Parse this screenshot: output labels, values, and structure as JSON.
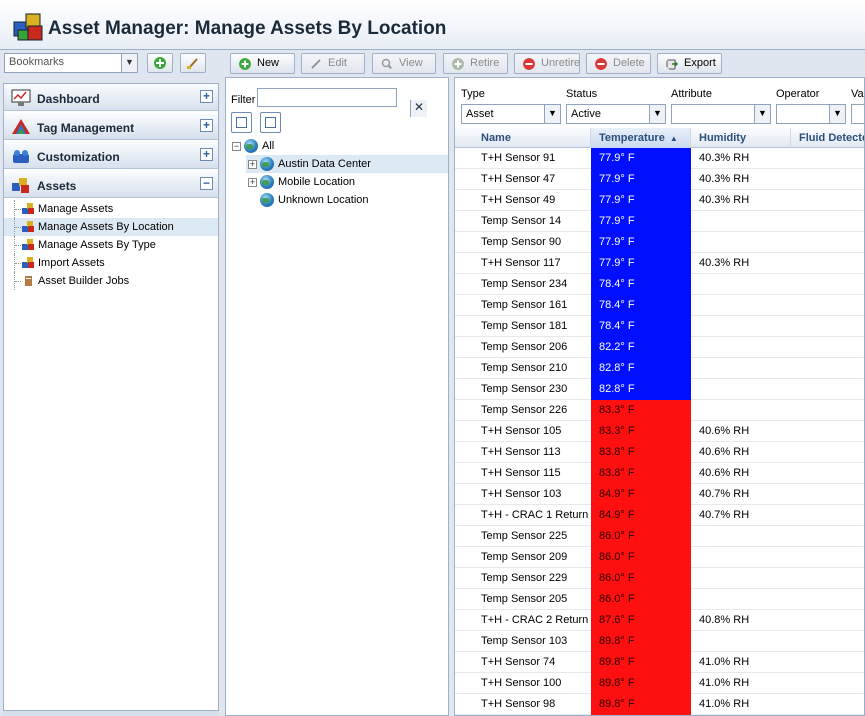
{
  "app": {
    "title": "Asset Manager: Manage Assets By Location"
  },
  "toolbar": {
    "bookmarks_placeholder": "Bookmarks",
    "buttons": [
      {
        "label": "New",
        "enabled": true,
        "icon": "plus-circle-icon"
      },
      {
        "label": "Edit",
        "enabled": false,
        "icon": "pencil-icon"
      },
      {
        "label": "View",
        "enabled": false,
        "icon": "magnifier-icon"
      },
      {
        "label": "Retire",
        "enabled": false,
        "icon": "retire-icon"
      },
      {
        "label": "Unretire",
        "enabled": false,
        "icon": "red-circle-icon"
      },
      {
        "label": "Delete",
        "enabled": false,
        "icon": "delete-icon"
      },
      {
        "label": "Export",
        "enabled": true,
        "icon": "export-icon"
      }
    ]
  },
  "sidebar": {
    "sections": [
      {
        "label": "Dashboard",
        "toggle": "+"
      },
      {
        "label": "Tag Management",
        "toggle": "+"
      },
      {
        "label": "Customization",
        "toggle": "+"
      },
      {
        "label": "Assets",
        "toggle": "−"
      }
    ],
    "items": [
      {
        "label": "Manage Assets",
        "selected": false
      },
      {
        "label": "Manage Assets By Location",
        "selected": true
      },
      {
        "label": "Manage Assets By Type",
        "selected": false
      },
      {
        "label": "Import Assets",
        "selected": false
      },
      {
        "label": "Asset Builder Jobs",
        "selected": false
      }
    ]
  },
  "tree": {
    "filter_label": "Filter",
    "filter_value": "",
    "root": "All",
    "nodes": [
      {
        "label": "Austin Data Center",
        "selected": true,
        "expandable": true
      },
      {
        "label": "Mobile Location",
        "selected": false,
        "expandable": true
      },
      {
        "label": "Unknown Location",
        "selected": false,
        "expandable": false
      }
    ]
  },
  "filters": {
    "type": {
      "label": "Type",
      "value": "Asset"
    },
    "status": {
      "label": "Status",
      "value": "Active"
    },
    "attribute": {
      "label": "Attribute",
      "value": ""
    },
    "operator": {
      "label": "Operator",
      "value": ""
    },
    "value": {
      "label": "Val",
      "value": ""
    }
  },
  "grid": {
    "columns": [
      "Name",
      "Temperature",
      "Humidity",
      "Fluid Detecte"
    ],
    "sorted_column": "Temperature",
    "sort_indicator": "▲",
    "colors": {
      "cool": "#0010ff",
      "hot": "#ff1010"
    },
    "rows": [
      {
        "name": "T+H Sensor 91",
        "temp": "77.9° F",
        "hum": "40.3% RH",
        "level": "cool"
      },
      {
        "name": "T+H Sensor 47",
        "temp": "77.9° F",
        "hum": "40.3% RH",
        "level": "cool"
      },
      {
        "name": "T+H Sensor 49",
        "temp": "77.9° F",
        "hum": "40.3% RH",
        "level": "cool"
      },
      {
        "name": "Temp Sensor 14",
        "temp": "77.9° F",
        "hum": "",
        "level": "cool"
      },
      {
        "name": "Temp Sensor 90",
        "temp": "77.9° F",
        "hum": "",
        "level": "cool"
      },
      {
        "name": "T+H Sensor 117",
        "temp": "77.9° F",
        "hum": "40.3% RH",
        "level": "cool"
      },
      {
        "name": "Temp Sensor 234",
        "temp": "78.4° F",
        "hum": "",
        "level": "cool"
      },
      {
        "name": "Temp Sensor 161",
        "temp": "78.4° F",
        "hum": "",
        "level": "cool"
      },
      {
        "name": "Temp Sensor 181",
        "temp": "78.4° F",
        "hum": "",
        "level": "cool"
      },
      {
        "name": "Temp Sensor 206",
        "temp": "82.2° F",
        "hum": "",
        "level": "cool"
      },
      {
        "name": "Temp Sensor 210",
        "temp": "82.8° F",
        "hum": "",
        "level": "cool"
      },
      {
        "name": "Temp Sensor 230",
        "temp": "82.8° F",
        "hum": "",
        "level": "cool"
      },
      {
        "name": "Temp Sensor 226",
        "temp": "83.3° F",
        "hum": "",
        "level": "hot"
      },
      {
        "name": "T+H Sensor 105",
        "temp": "83.3° F",
        "hum": "40.6% RH",
        "level": "hot"
      },
      {
        "name": "T+H Sensor 113",
        "temp": "83.8° F",
        "hum": "40.6% RH",
        "level": "hot"
      },
      {
        "name": "T+H Sensor 115",
        "temp": "83.8° F",
        "hum": "40.6% RH",
        "level": "hot"
      },
      {
        "name": "T+H Sensor 103",
        "temp": "84.9° F",
        "hum": "40.7% RH",
        "level": "hot"
      },
      {
        "name": "T+H - CRAC 1 Return",
        "temp": "84.9° F",
        "hum": "40.7% RH",
        "level": "hot"
      },
      {
        "name": "Temp Sensor 225",
        "temp": "86.0° F",
        "hum": "",
        "level": "hot"
      },
      {
        "name": "Temp Sensor 209",
        "temp": "86.0° F",
        "hum": "",
        "level": "hot"
      },
      {
        "name": "Temp Sensor 229",
        "temp": "86.0° F",
        "hum": "",
        "level": "hot"
      },
      {
        "name": "Temp Sensor 205",
        "temp": "86.0° F",
        "hum": "",
        "level": "hot"
      },
      {
        "name": "T+H - CRAC 2 Return",
        "temp": "87.6° F",
        "hum": "40.8% RH",
        "level": "hot"
      },
      {
        "name": "Temp Sensor 103",
        "temp": "89.8° F",
        "hum": "",
        "level": "hot"
      },
      {
        "name": "T+H Sensor 74",
        "temp": "89.8° F",
        "hum": "41.0% RH",
        "level": "hot"
      },
      {
        "name": "T+H Sensor 100",
        "temp": "89.8° F",
        "hum": "41.0% RH",
        "level": "hot"
      },
      {
        "name": "T+H Sensor 98",
        "temp": "89.8° F",
        "hum": "41.0% RH",
        "level": "hot"
      }
    ]
  }
}
